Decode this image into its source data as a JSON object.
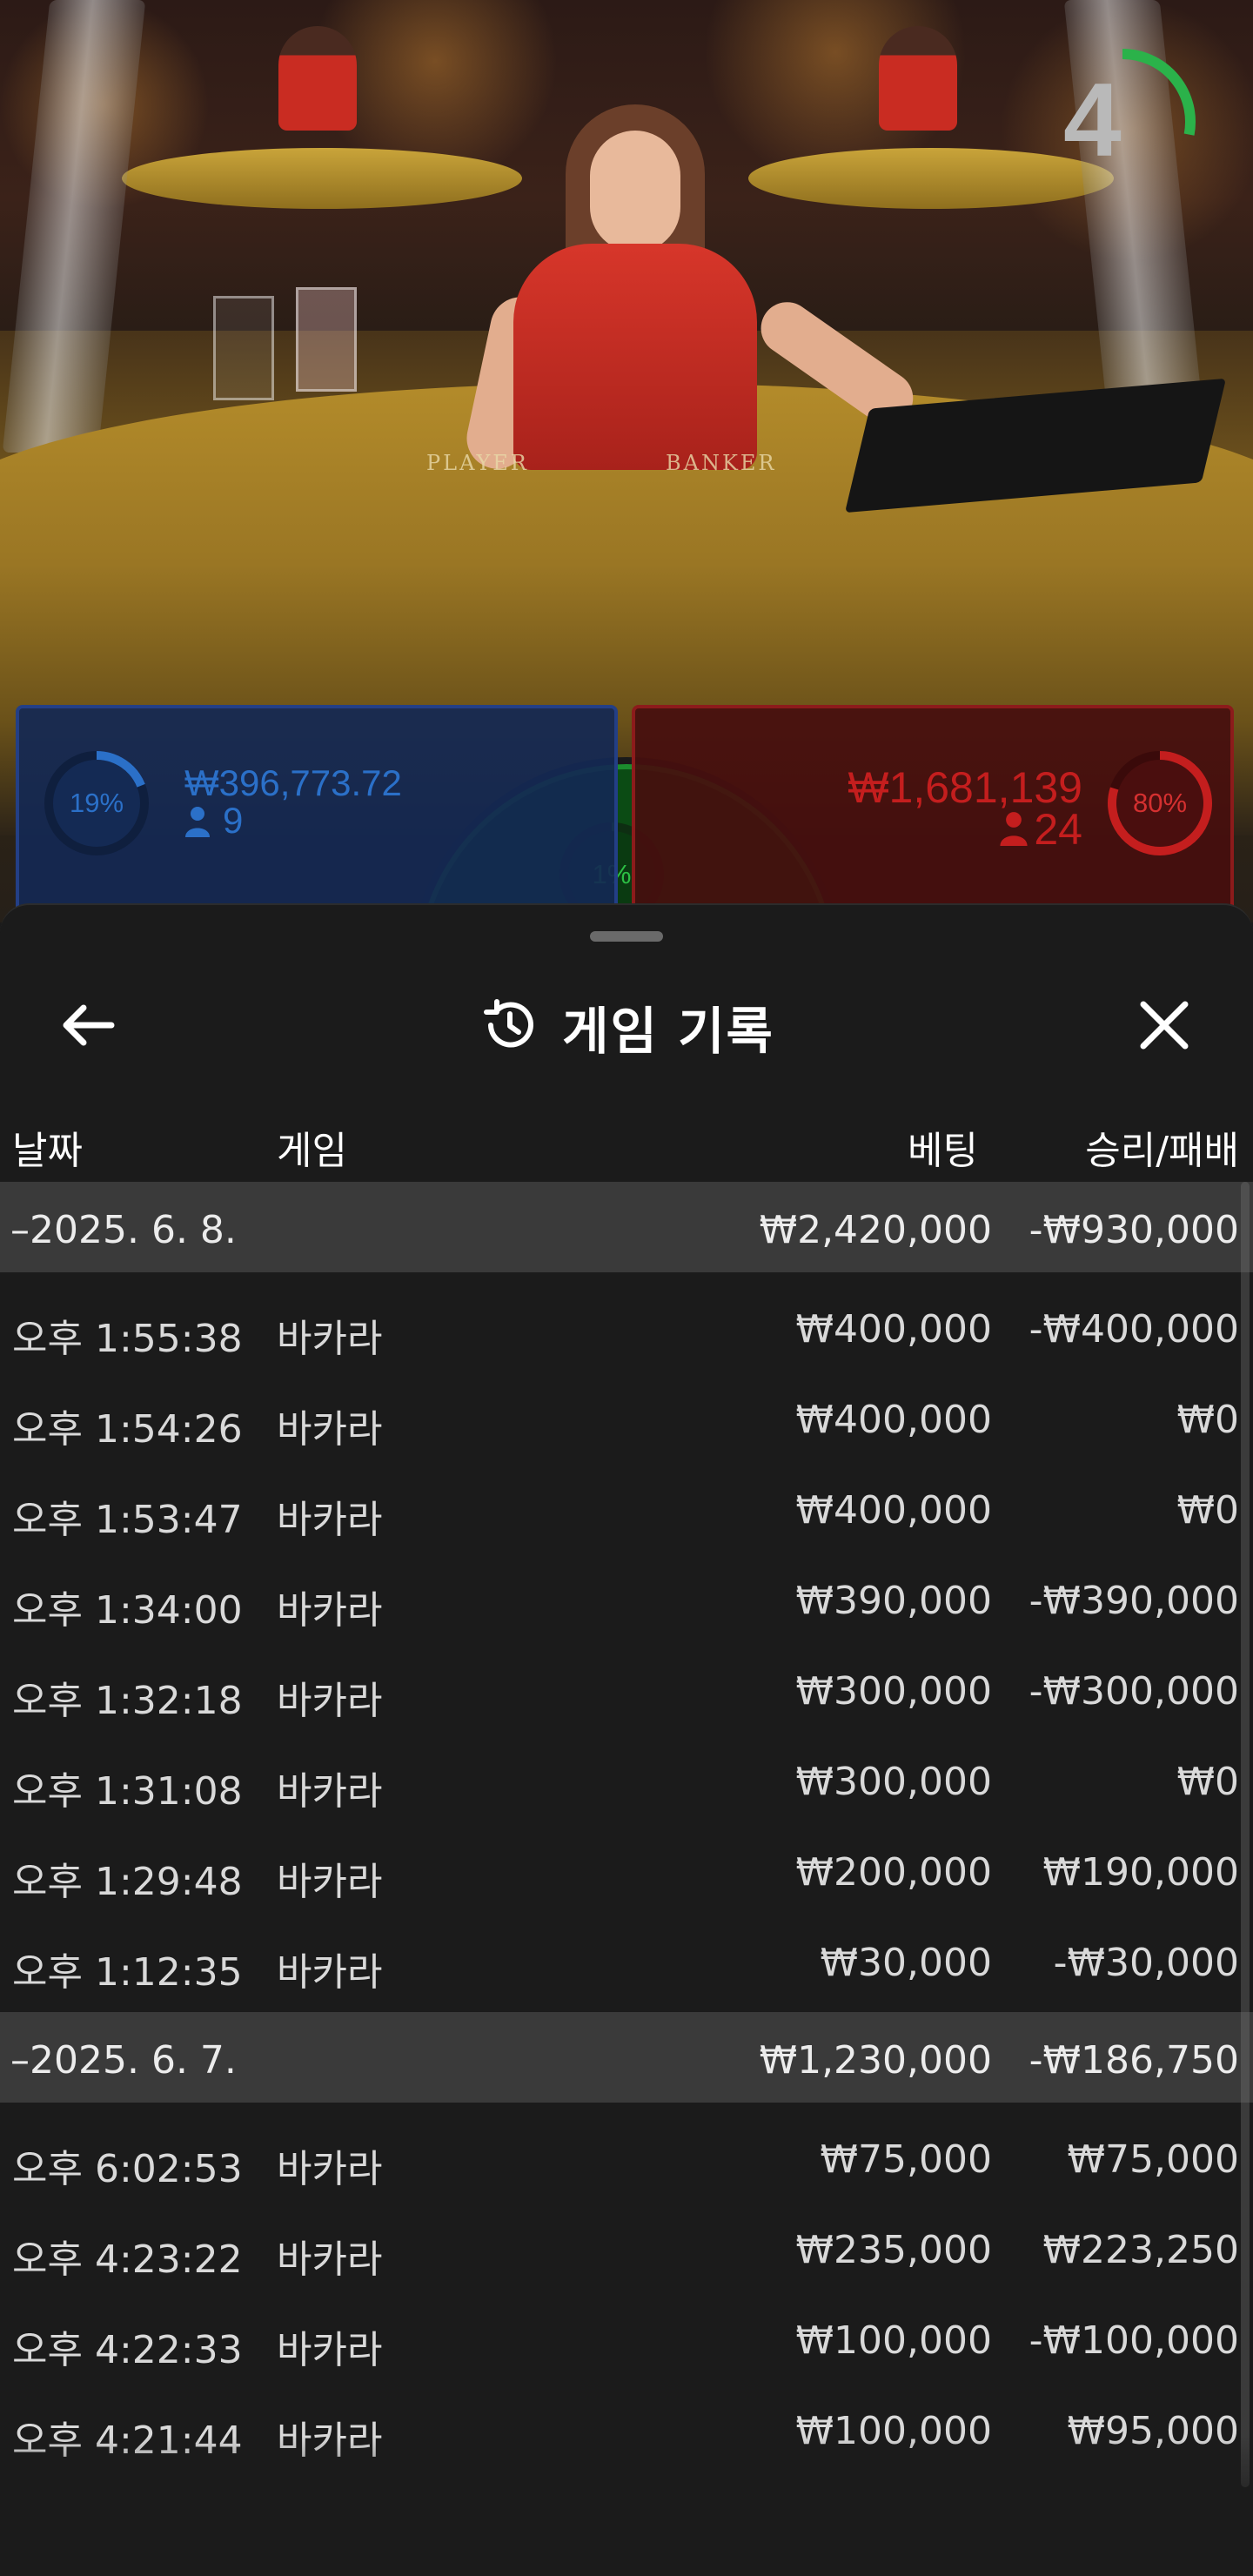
{
  "video": {
    "table_labels": {
      "player": "PLAYER",
      "banker": "BANKER"
    },
    "countdown": {
      "value": "4",
      "progress": 0.28,
      "color": "#2bb24a"
    }
  },
  "bet_bar": {
    "player": {
      "percent": "19%",
      "percent_value": 19,
      "amount": "₩396,773.72",
      "players": "9",
      "color": "#2b70c8",
      "icon": "person-icon"
    },
    "tie": {
      "percent": "1%",
      "percent_value": 1,
      "color": "#1c8c2e"
    },
    "banker": {
      "percent": "80%",
      "percent_value": 80,
      "amount": "₩1,681,139",
      "players": "24",
      "color": "#c41e1e",
      "icon": "person-icon"
    }
  },
  "sheet": {
    "title": "게임 기록",
    "icons": {
      "back": "arrow-left-icon",
      "history": "history-clock-icon",
      "close": "close-icon"
    },
    "columns": {
      "date": "날짜",
      "game": "게임",
      "bet": "베팅",
      "result": "승리/패배"
    },
    "groups": [
      {
        "date": "–2025. 6. 8.",
        "total_bet": "₩2,420,000",
        "total_result": "-₩930,000",
        "rows": [
          {
            "time": "오후 1:55:38",
            "game": "바카라",
            "bet": "₩400,000",
            "result": "-₩400,000"
          },
          {
            "time": "오후 1:54:26",
            "game": "바카라",
            "bet": "₩400,000",
            "result": "₩0"
          },
          {
            "time": "오후 1:53:47",
            "game": "바카라",
            "bet": "₩400,000",
            "result": "₩0"
          },
          {
            "time": "오후 1:34:00",
            "game": "바카라",
            "bet": "₩390,000",
            "result": "-₩390,000"
          },
          {
            "time": "오후 1:32:18",
            "game": "바카라",
            "bet": "₩300,000",
            "result": "-₩300,000"
          },
          {
            "time": "오후 1:31:08",
            "game": "바카라",
            "bet": "₩300,000",
            "result": "₩0"
          },
          {
            "time": "오후 1:29:48",
            "game": "바카라",
            "bet": "₩200,000",
            "result": "₩190,000"
          },
          {
            "time": "오후 1:12:35",
            "game": "바카라",
            "bet": "₩30,000",
            "result": "-₩30,000"
          }
        ]
      },
      {
        "date": "–2025. 6. 7.",
        "total_bet": "₩1,230,000",
        "total_result": "-₩186,750",
        "rows": [
          {
            "time": "오후 6:02:53",
            "game": "바카라",
            "bet": "₩75,000",
            "result": "₩75,000"
          },
          {
            "time": "오후 4:23:22",
            "game": "바카라",
            "bet": "₩235,000",
            "result": "₩223,250"
          },
          {
            "time": "오후 4:22:33",
            "game": "바카라",
            "bet": "₩100,000",
            "result": "-₩100,000"
          },
          {
            "time": "오후 4:21:44",
            "game": "바카라",
            "bet": "₩100,000",
            "result": "₩95,000"
          }
        ]
      }
    ]
  }
}
